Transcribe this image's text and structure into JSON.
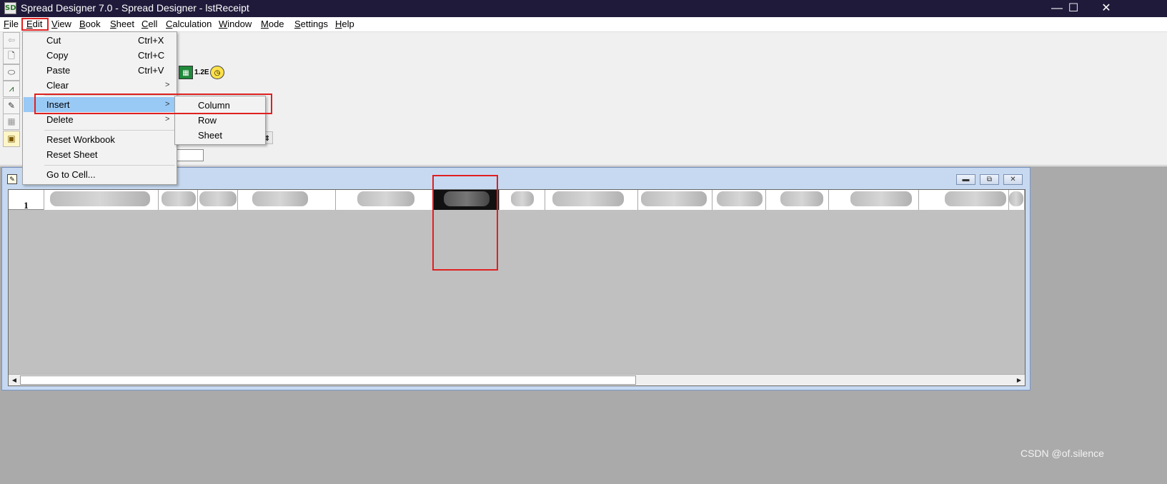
{
  "window": {
    "title": "Spread Designer 7.0 - Spread Designer - lstReceipt",
    "icon_text": "SD",
    "controls": [
      "—",
      "☐",
      "✕"
    ]
  },
  "menubar": [
    {
      "label": "File",
      "u": "F",
      "rest": "ile"
    },
    {
      "label": "Edit",
      "u": "E",
      "rest": "dit"
    },
    {
      "label": "View",
      "u": "V",
      "rest": "iew"
    },
    {
      "label": "Book",
      "u": "B",
      "rest": "ook"
    },
    {
      "label": "Sheet",
      "u": "S",
      "rest": "heet"
    },
    {
      "label": "Cell",
      "u": "C",
      "rest": "ell"
    },
    {
      "label": "Calculation",
      "u": "C",
      "rest": "alculation"
    },
    {
      "label": "Window",
      "u": "W",
      "rest": "indow"
    },
    {
      "label": "Mode",
      "u": "M",
      "rest": "ode"
    },
    {
      "label": "Settings",
      "u": "S",
      "rest": "ettings"
    },
    {
      "label": "Help",
      "u": "H",
      "rest": "elp"
    }
  ],
  "edit_menu": {
    "items": [
      {
        "label": "Cut",
        "shortcut": "Ctrl+X"
      },
      {
        "label": "Copy",
        "shortcut": "Ctrl+C"
      },
      {
        "label": "Paste",
        "shortcut": "Ctrl+V"
      },
      {
        "label": "Clear",
        "arrow": ">"
      },
      {
        "label": "Insert",
        "arrow": ">"
      },
      {
        "label": "Delete",
        "arrow": ">"
      },
      {
        "label": "Reset Workbook"
      },
      {
        "label": "Reset Sheet"
      },
      {
        "label": "Go to Cell..."
      }
    ],
    "highlighted": "Insert"
  },
  "insert_submenu": [
    "Column",
    "Row",
    "Sheet"
  ],
  "toolbar": {
    "number_format_icon": "1.2E"
  },
  "sheet": {
    "row_label": "1",
    "selected_column_color": "#111111"
  },
  "annotation_color": "#e02020",
  "watermark": "CSDN @of.silence"
}
